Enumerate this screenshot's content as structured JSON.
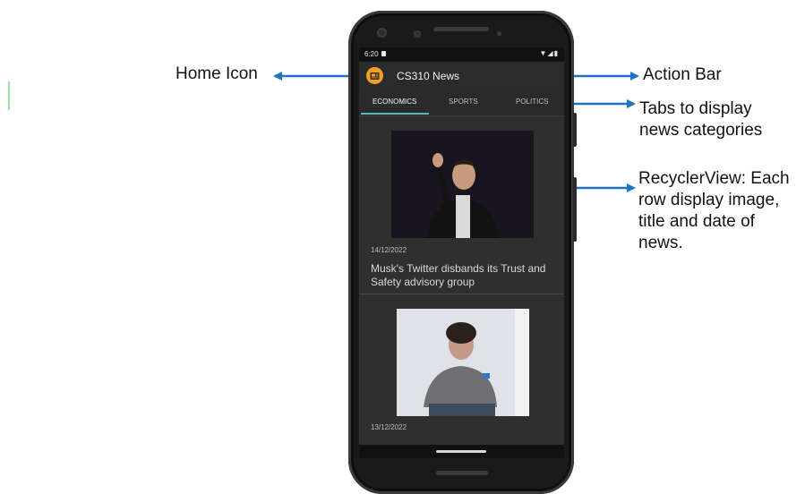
{
  "annotations": {
    "home_icon": "Home Icon",
    "action_bar": "Action Bar",
    "tabs_line1": "Tabs to display",
    "tabs_line2": "news categories",
    "recycler_line1": "RecyclerView: Each",
    "recycler_line2": "row display image,",
    "recycler_line3": "title and date of",
    "recycler_line4": "news."
  },
  "status_bar": {
    "time": "6:20",
    "icons": "wifi-icon signal-icon battery-icon"
  },
  "action_bar": {
    "title": "CS310 News",
    "icon": "newspaper-icon"
  },
  "tabs": [
    {
      "label": "ECONOMICS",
      "active": true
    },
    {
      "label": "SPORTS",
      "active": false
    },
    {
      "label": "POLITICS",
      "active": false
    }
  ],
  "news": [
    {
      "date": "14/12/2022",
      "title": "Musk's Twitter disbands its Trust and Safety advisory group",
      "image": "person-waving-photo"
    },
    {
      "date": "13/12/2022",
      "title": "",
      "image": "person-seated-photo"
    }
  ],
  "colors": {
    "accent": "#55b7bd",
    "home_icon": "#f2a02a",
    "arrow": "#1f74c2"
  }
}
